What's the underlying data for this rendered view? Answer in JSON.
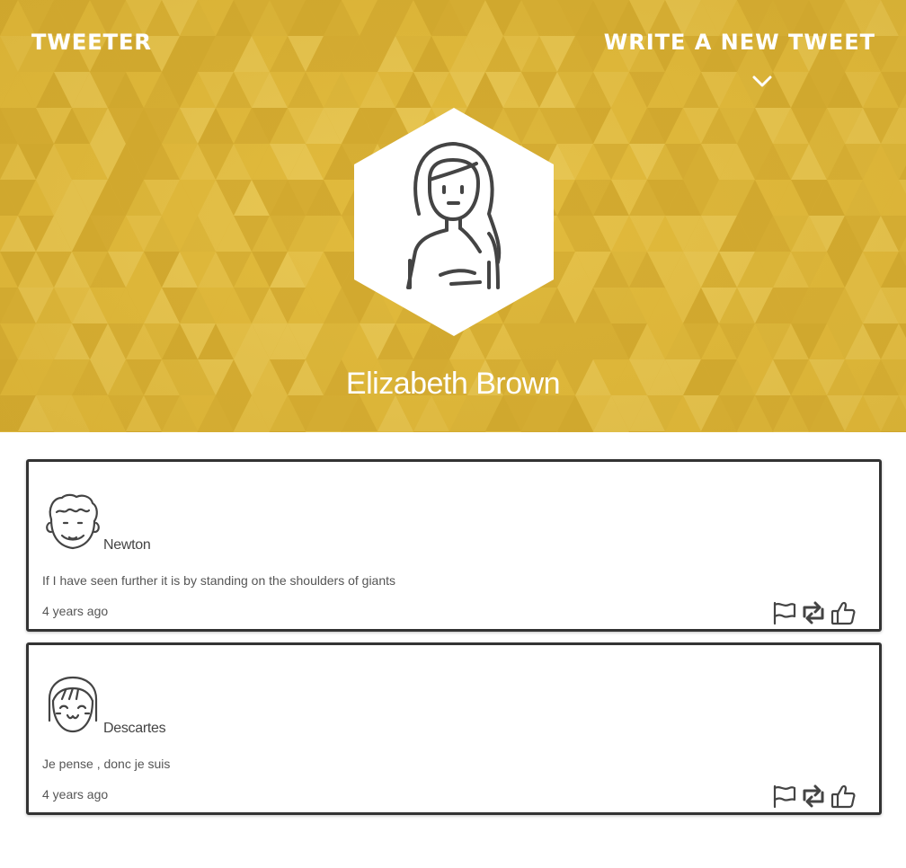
{
  "nav": {
    "brand": "TWEETER",
    "write_link": "WRITE A NEW TWEET"
  },
  "icons": {
    "chevron": "chevron-down-icon",
    "profile_avatar": "woman-avatar-icon",
    "flag": "flag-icon",
    "retweet": "retweet-icon",
    "like": "thumbs-up-icon"
  },
  "colors": {
    "hero_bg": "#dcb538",
    "text_light": "#ffffff",
    "card_border": "#333333"
  },
  "profile": {
    "name": "Elizabeth Brown"
  },
  "tweets": [
    {
      "author": "Newton",
      "avatar": "curly-hair-man-avatar-icon",
      "text": "If I have seen further it is by standing on the shoulders of giants",
      "time": "4 years ago"
    },
    {
      "author": "Descartes",
      "avatar": "bob-hair-woman-avatar-icon",
      "text": "Je pense , donc je suis",
      "time": "4 years ago"
    }
  ]
}
